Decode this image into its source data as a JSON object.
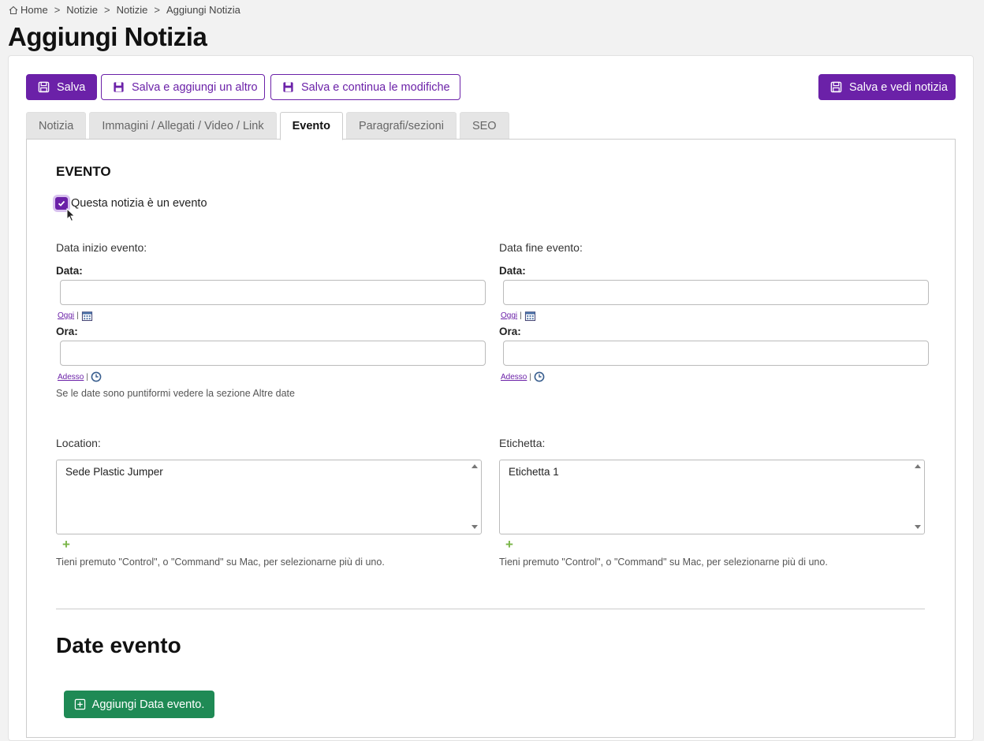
{
  "breadcrumb": {
    "home": "Home",
    "sep": ">",
    "crumb1": "Notizie",
    "crumb2": "Notizie",
    "current": "Aggiungi Notizia"
  },
  "page_title": "Aggiungi Notizia",
  "toolbar": {
    "save": "Salva",
    "save_add": "Salva e aggiungi un altro",
    "save_continue": "Salva e continua le modifiche",
    "save_view": "Salva e vedi notizia"
  },
  "tabs": [
    "Notizia",
    "Immagini / Allegati / Video / Link",
    "Evento",
    "Paragrafi/sezioni",
    "SEO"
  ],
  "evento": {
    "heading": "EVENTO",
    "checkbox_label": "Questa notizia è un evento",
    "start_label": "Data inizio evento:",
    "end_label": "Data fine evento:",
    "date_label": "Data:",
    "time_label": "Ora:",
    "today_link": "Oggi",
    "now_link": "Adesso",
    "pipe": "|",
    "date_help": "Se le date sono puntiformi vedere la sezione Altre date",
    "location_label": "Location:",
    "location_option": "Sede Plastic Jumper",
    "tag_label": "Etichetta:",
    "tag_option": "Etichetta 1",
    "add_symbol": "+",
    "multi_help": "Tieni premuto \"Control\", o \"Command\" su Mac, per selezionarne più di uno."
  },
  "date_evento": {
    "heading": "Date evento",
    "add_button": "Aggiungi Data evento."
  },
  "colors": {
    "primary": "#6b21a8",
    "success": "#1f8a55",
    "plus": "#7ab648"
  },
  "icons": [
    "home-icon",
    "save-icon",
    "calendar-icon",
    "clock-icon",
    "plus-square-icon",
    "mouse-cursor-icon"
  ]
}
